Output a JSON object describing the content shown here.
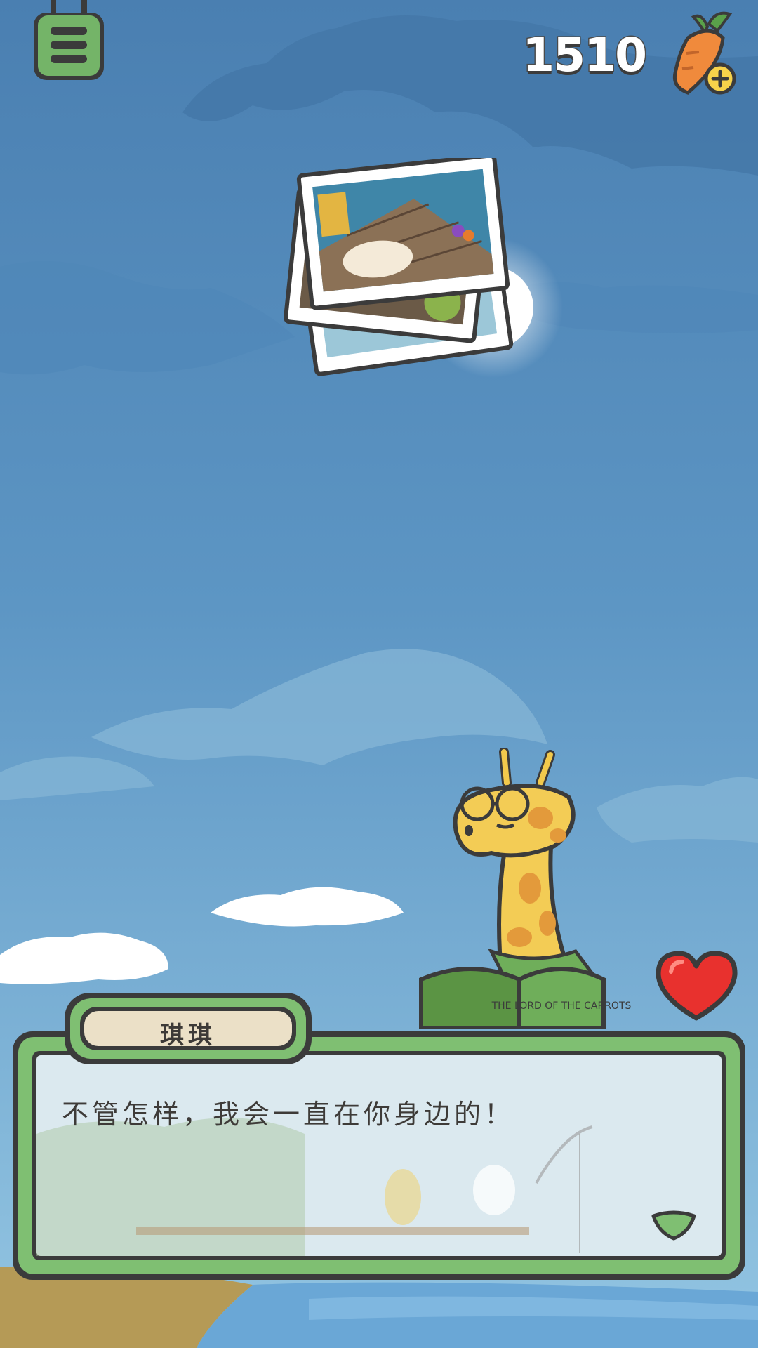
{
  "hud": {
    "carrot_count": "1510"
  },
  "dialog": {
    "speaker": "琪琪",
    "text": "不管怎样，我会一直在你身边的！"
  },
  "book": {
    "cover_text": "THE LORD OF THE CARROTS"
  },
  "colors": {
    "sky_top": "#4f84b4",
    "sky_bottom": "#8ec1df",
    "ui_green": "#7fbf72",
    "ui_outline": "#3b3b3b",
    "name_plate": "#ebe0c7",
    "heart": "#e8312e"
  },
  "icons": {
    "menu": "menu-list-icon",
    "carrot": "carrot-plus-icon",
    "photos": "photo-stack-icon",
    "heart": "heart-icon",
    "next": "next-arrow-icon"
  }
}
